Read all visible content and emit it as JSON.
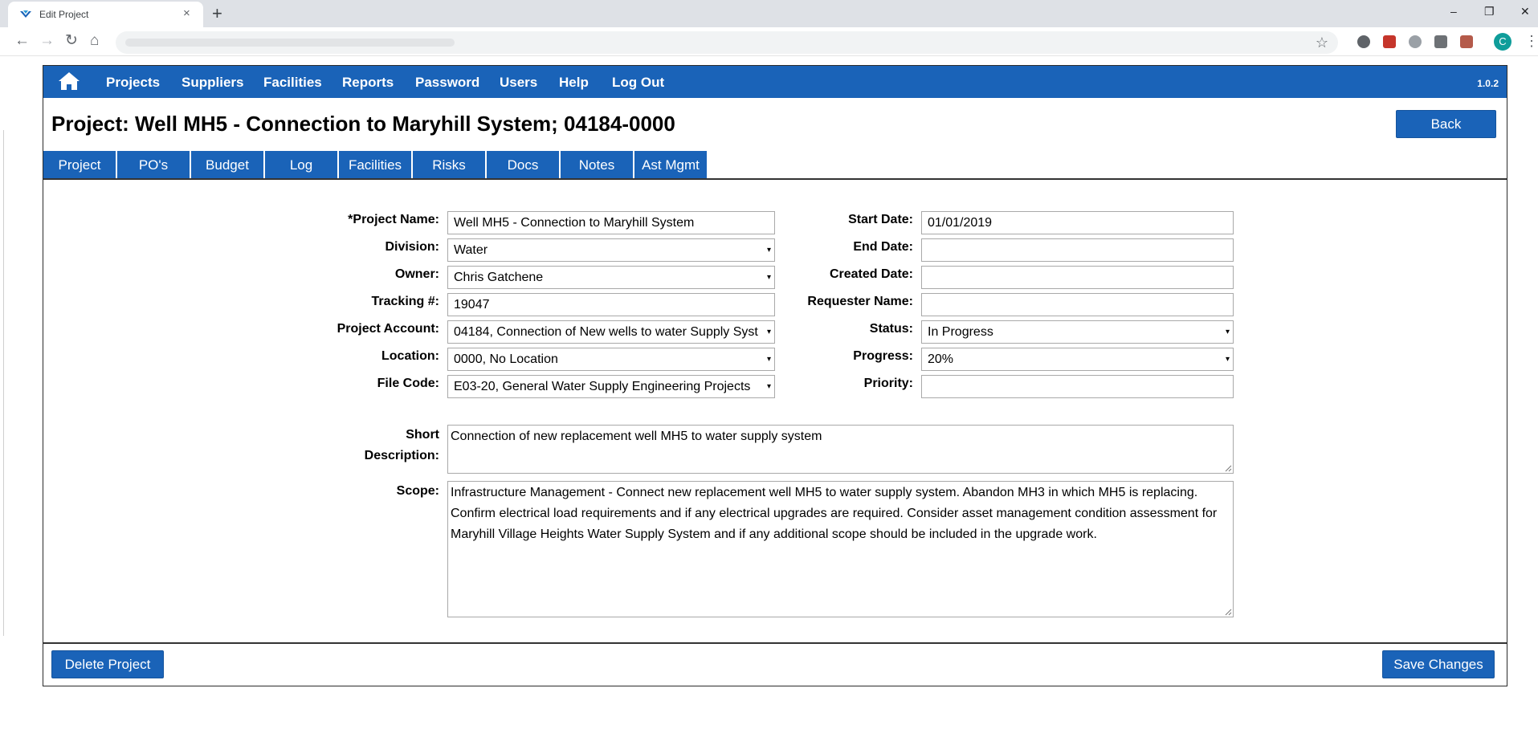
{
  "browser": {
    "tab_title": "Edit Project",
    "tab_close": "×",
    "new_tab": "+",
    "minimize": "–",
    "restore": "❐",
    "close": "✕",
    "back_glyph": "←",
    "forward_glyph": "→",
    "reload_glyph": "↻",
    "home_glyph": "⌂",
    "star_glyph": "☆",
    "avatar_letter": "C",
    "menu_glyph": "⋮"
  },
  "navbar": {
    "items": [
      "Projects",
      "Suppliers",
      "Facilities",
      "Reports",
      "Password",
      "Users",
      "Help",
      "Log Out"
    ],
    "version": "1.0.2",
    "color": "#1a63b8"
  },
  "header": {
    "title": "Project: Well MH5 - Connection to Maryhill System; 04184-0000",
    "back_label": "Back"
  },
  "tabs": [
    "Project",
    "PO's",
    "Budget",
    "Log",
    "Facilities",
    "Risks",
    "Docs",
    "Notes",
    "Ast Mgmt"
  ],
  "form": {
    "project_name_label": "*Project Name:",
    "project_name": "Well MH5 - Connection to Maryhill System",
    "division_label": "Division:",
    "division": "Water",
    "owner_label": "Owner:",
    "owner": "Chris Gatchene",
    "tracking_label": "Tracking #:",
    "tracking": "19047",
    "account_label": "Project Account:",
    "account": "04184, Connection of New wells to water Supply Syst",
    "location_label": "Location:",
    "location": "0000, No Location",
    "file_code_label": "File Code:",
    "file_code": "E03-20, General Water Supply Engineering Projects",
    "start_date_label": "Start Date:",
    "start_date": "01/01/2019",
    "end_date_label": "End Date:",
    "end_date": "",
    "created_date_label": "Created Date:",
    "created_date": "",
    "requester_label": "Requester Name:",
    "requester": "",
    "status_label": "Status:",
    "status": "In Progress",
    "progress_label": "Progress:",
    "progress": "20%",
    "priority_label": "Priority:",
    "priority": "",
    "short_desc_label_1": "Short",
    "short_desc_label_2": "Description:",
    "short_description": "Connection of new replacement well MH5 to water supply system",
    "scope_label": "Scope:",
    "scope": "Infrastructure Management - Connect new replacement well MH5 to water supply system.  Abandon MH3 in which MH5 is replacing.  Confirm electrical load requirements and if any electrical upgrades are required.  Consider asset management condition assessment for Maryhill Village Heights Water Supply System and if any additional scope should be included in the upgrade work."
  },
  "footer": {
    "delete_label": "Delete Project",
    "save_label": "Save Changes"
  },
  "select_caret": "▾"
}
